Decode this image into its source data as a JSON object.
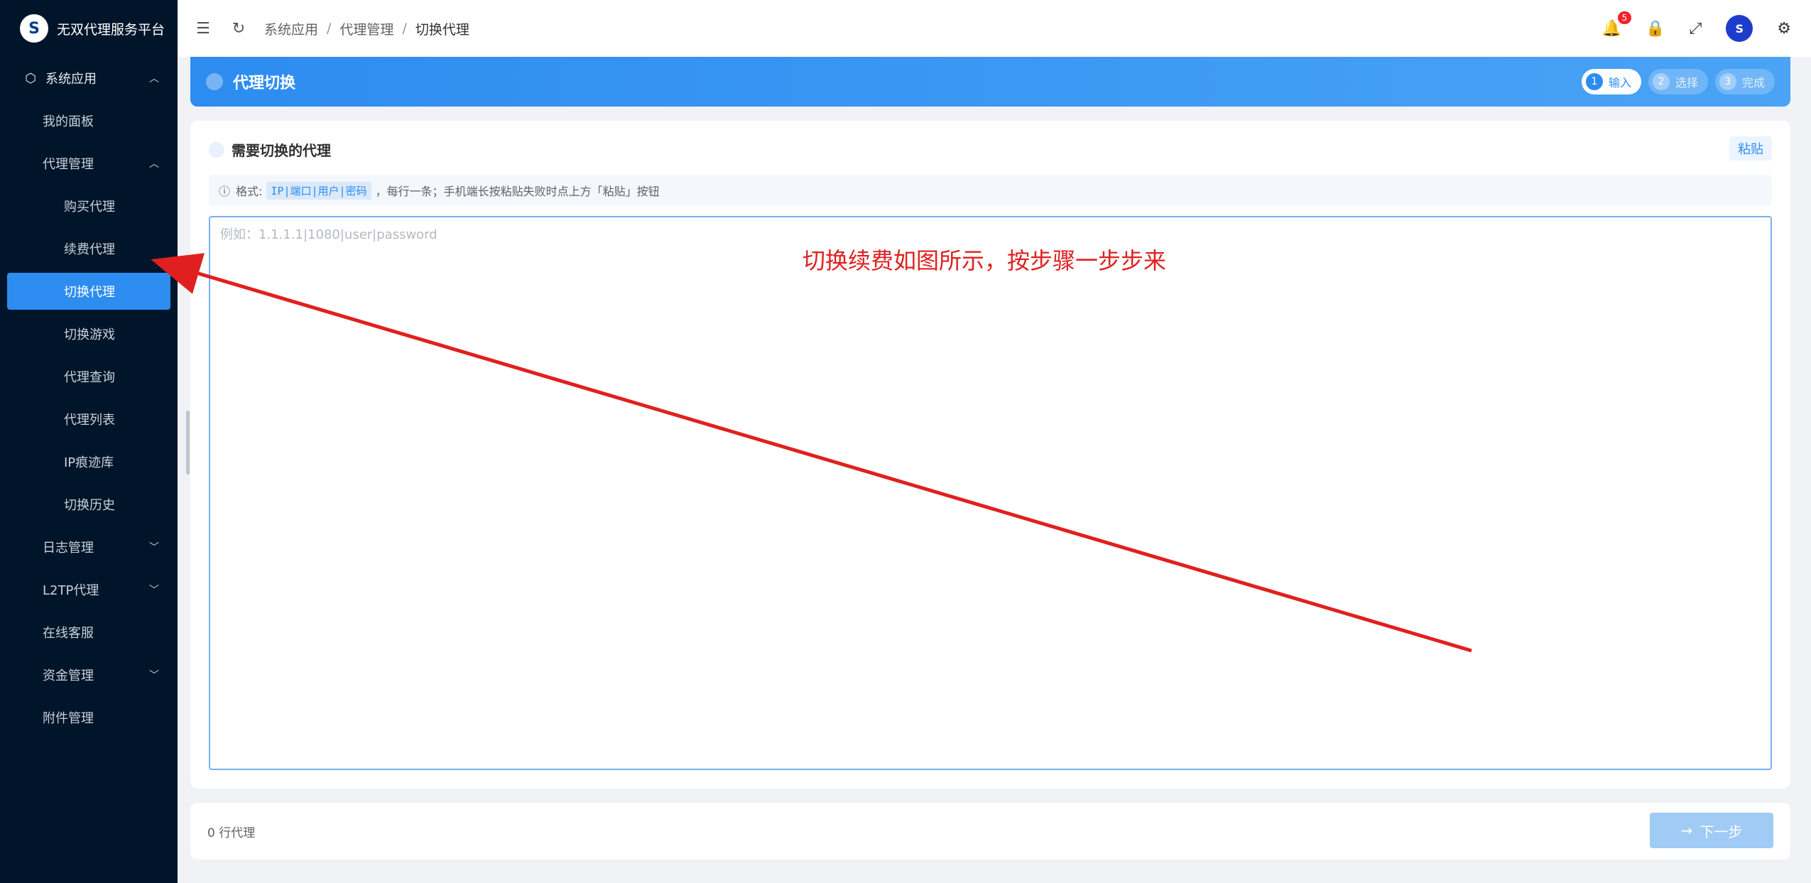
{
  "brand": {
    "title": "无双代理服务平台",
    "logo_text": "S"
  },
  "sidebar": {
    "items": [
      {
        "label": "系统应用"
      },
      {
        "label": "我的面板"
      },
      {
        "label": "代理管理"
      },
      {
        "label": "购买代理"
      },
      {
        "label": "续费代理"
      },
      {
        "label": "切换代理"
      },
      {
        "label": "切换游戏"
      },
      {
        "label": "代理查询"
      },
      {
        "label": "代理列表"
      },
      {
        "label": "IP痕迹库"
      },
      {
        "label": "切换历史"
      },
      {
        "label": "日志管理"
      },
      {
        "label": "L2TP代理"
      },
      {
        "label": "在线客服"
      },
      {
        "label": "资金管理"
      },
      {
        "label": "附件管理"
      }
    ]
  },
  "header": {
    "breadcrumb": [
      "系统应用",
      "代理管理",
      "切换代理"
    ],
    "notification_count": "5"
  },
  "banner": {
    "title": "代理切换",
    "steps": [
      {
        "num": "1",
        "label": "输入"
      },
      {
        "num": "2",
        "label": "选择"
      },
      {
        "num": "3",
        "label": "完成"
      }
    ]
  },
  "card": {
    "title": "需要切换的代理",
    "paste_label": "粘贴",
    "hint_prefix": "格式:",
    "hint_code": "IP|端口|用户|密码",
    "hint_suffix": "，每行一条；手机端长按粘贴失败时点上方「粘贴」按钮",
    "input_placeholder": "例如：1.1.1.1|1080|user|password",
    "input_value": ""
  },
  "annotation": {
    "text": "切换续费如图所示，按步骤一步步来",
    "color": "#e02020"
  },
  "footer": {
    "count_text": "0 行代理",
    "next_label": "下一步"
  },
  "colors": {
    "accent": "#2d8cf0",
    "sidebar_bg": "#001529",
    "annotation": "#e02020"
  }
}
